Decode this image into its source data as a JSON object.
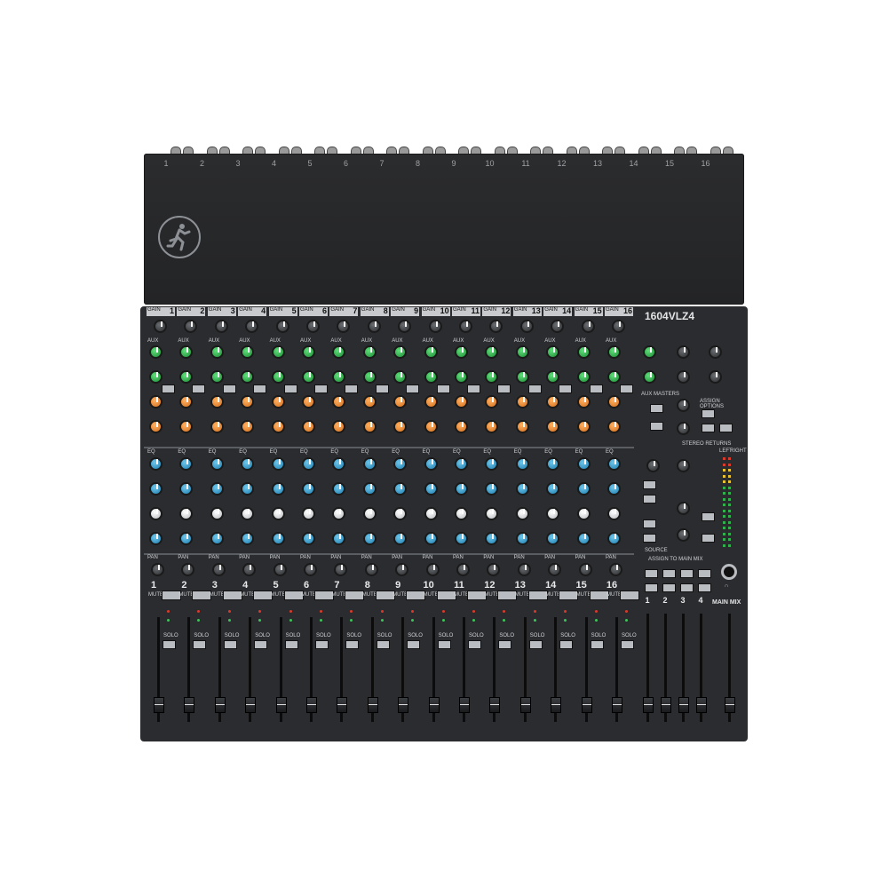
{
  "lid": {
    "input_numbers": [
      "1",
      "2",
      "3",
      "4",
      "5",
      "6",
      "7",
      "8",
      "9",
      "10",
      "11",
      "12",
      "13",
      "14",
      "15",
      "16"
    ]
  },
  "logo": {
    "icon": "running-man-logo-icon"
  },
  "channels": [
    {
      "num": "1"
    },
    {
      "num": "2"
    },
    {
      "num": "3"
    },
    {
      "num": "4"
    },
    {
      "num": "5"
    },
    {
      "num": "6"
    },
    {
      "num": "7"
    },
    {
      "num": "8"
    },
    {
      "num": "9"
    },
    {
      "num": "10"
    },
    {
      "num": "11"
    },
    {
      "num": "12"
    },
    {
      "num": "13"
    },
    {
      "num": "14"
    },
    {
      "num": "15"
    },
    {
      "num": "16"
    }
  ],
  "strip_labels": {
    "gain": "GAIN",
    "aux": "AUX",
    "eq": "EQ",
    "pan": "PAN",
    "mute": "MUTE",
    "solo": "SOLO"
  },
  "master": {
    "model": "1604VLZ4",
    "aux_masters": "AUX MASTERS",
    "assign_options": "ASSIGN OPTIONS",
    "stereo_returns": "STEREO RETURNS",
    "assign_to_main_mix": "ASSIGN TO MAIN MIX",
    "source": "SOURCE",
    "main_mix": "MAIN MIX",
    "left": "LEFT",
    "right": "RIGHT",
    "group_numbers": [
      "1",
      "2",
      "3",
      "4"
    ]
  },
  "colors": {
    "aux_green": "#2fb24c",
    "aux_orange": "#e88a2e",
    "eq_blue": "#2b9bd1",
    "eq_white": "#e6e7e9",
    "body": "#2a2c2f"
  }
}
